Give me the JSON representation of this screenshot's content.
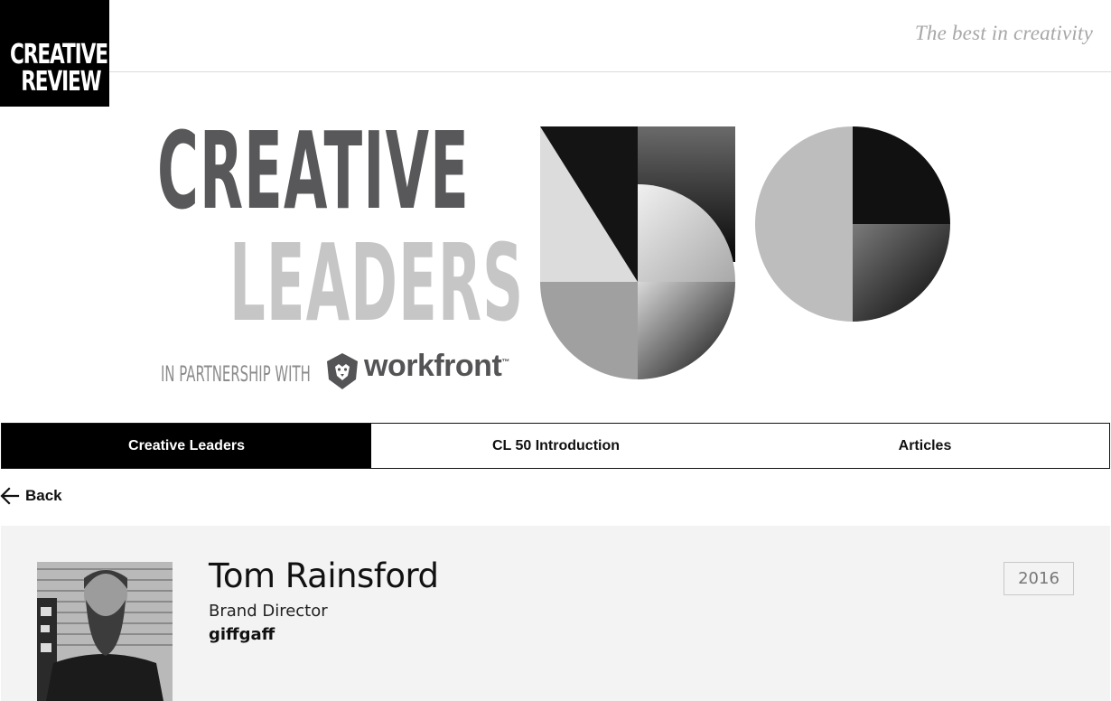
{
  "header": {
    "logo_line1": "CREATIVE",
    "logo_line2": "REVIEW",
    "tagline": "The best in creativity"
  },
  "banner": {
    "title_line1": "CREATIVE",
    "title_line2": "LEADERS",
    "partnership_text": "IN PARTNERSHIP WITH",
    "partner_name": "workfront",
    "partner_mark": "™",
    "graphic_number": "50"
  },
  "nav": {
    "tabs": [
      {
        "label": "Creative Leaders",
        "active": true
      },
      {
        "label": "CL 50 Introduction",
        "active": false
      },
      {
        "label": "Articles",
        "active": false
      }
    ]
  },
  "back": {
    "label": "Back",
    "icon": "arrow-left-icon"
  },
  "profile": {
    "name": "Tom Rainsford",
    "role": "Brand Director",
    "company": "giffgaff",
    "year": "2016"
  },
  "colors": {
    "nav_active_bg": "#000000",
    "profile_bg": "#f3f3f3",
    "title_dark": "#58585a",
    "title_light": "#c6c6c7",
    "tagline": "#a7a7a7"
  }
}
